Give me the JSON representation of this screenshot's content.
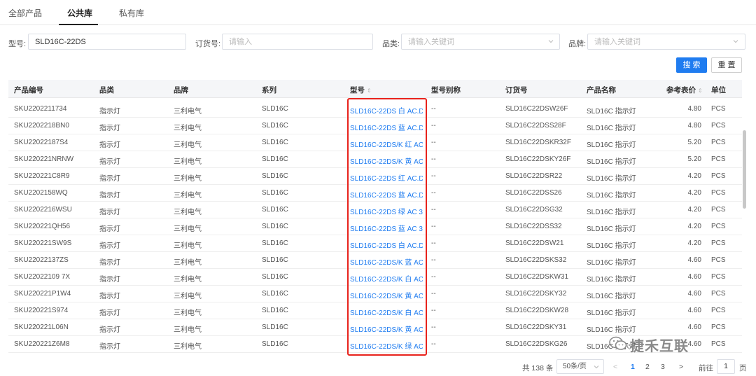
{
  "tabs": [
    {
      "label": "全部产品",
      "active": false
    },
    {
      "label": "公共库",
      "active": true
    },
    {
      "label": "私有库",
      "active": false
    }
  ],
  "filters": {
    "model": {
      "label": "型号:",
      "value": "SLD16C-22DS"
    },
    "order_no": {
      "label": "订货号:",
      "placeholder": "请输入"
    },
    "category": {
      "label": "品类:",
      "placeholder": "请输入关键词"
    },
    "brand": {
      "label": "品牌:",
      "placeholder": "请输入关键词"
    }
  },
  "buttons": {
    "search": "搜 索",
    "reset": "重 置"
  },
  "table": {
    "headers": [
      "产品编号",
      "品类",
      "品牌",
      "系列",
      "型号",
      "型号别称",
      "订货号",
      "产品名称",
      "参考表价",
      "单位"
    ],
    "rows": [
      [
        "SKU2202211734",
        "指示灯",
        "三利电气",
        "SLD16C",
        "SLD16C-22DS 白 AC.D...",
        "--",
        "SLD16C22DSW26F",
        "SLD16C 指示灯",
        "4.80",
        "PCS"
      ],
      [
        "SKU2202218BN0",
        "指示灯",
        "三利电气",
        "SLD16C",
        "SLD16C-22DS 蓝 AC.D...",
        "--",
        "SLD16C22DSS28F",
        "SLD16C 指示灯",
        "4.80",
        "PCS"
      ],
      [
        "SKU22022187S4",
        "指示灯",
        "三利电气",
        "SLD16C",
        "SLD16C-22DS/K 红 AC ...",
        "--",
        "SLD16C22DSKR32F",
        "SLD16C 指示灯",
        "5.20",
        "PCS"
      ],
      [
        "SKU220221NRNW",
        "指示灯",
        "三利电气",
        "SLD16C",
        "SLD16C-22DS/K 黄 AC...",
        "--",
        "SLD16C22DSKY26F",
        "SLD16C 指示灯",
        "5.20",
        "PCS"
      ],
      [
        "SKU220221C8R9",
        "指示灯",
        "三利电气",
        "SLD16C",
        "SLD16C-22DS 红 AC.D...",
        "--",
        "SLD16C22DSR22",
        "SLD16C 指示灯",
        "4.20",
        "PCS"
      ],
      [
        "SKU2202158WQ",
        "指示灯",
        "三利电气",
        "SLD16C",
        "SLD16C-22DS 蓝 AC.D...",
        "--",
        "SLD16C22DSS26",
        "SLD16C 指示灯",
        "4.20",
        "PCS"
      ],
      [
        "SKU2202216WSU",
        "指示灯",
        "三利电气",
        "SLD16C",
        "SLD16C-22DS 绿 AC 38...",
        "--",
        "SLD16C22DSG32",
        "SLD16C 指示灯",
        "4.20",
        "PCS"
      ],
      [
        "SKU220221QH56",
        "指示灯",
        "三利电气",
        "SLD16C",
        "SLD16C-22DS 蓝 AC 38...",
        "--",
        "SLD16C22DSS32",
        "SLD16C 指示灯",
        "4.20",
        "PCS"
      ],
      [
        "SKU220221SW9S",
        "指示灯",
        "三利电气",
        "SLD16C",
        "SLD16C-22DS 白 AC.D...",
        "--",
        "SLD16C22DSW21",
        "SLD16C 指示灯",
        "4.20",
        "PCS"
      ],
      [
        "SKU22022137ZS",
        "指示灯",
        "三利电气",
        "SLD16C",
        "SLD16C-22DS/K 蓝 AC...",
        "--",
        "SLD16C22DSKS32",
        "SLD16C 指示灯",
        "4.60",
        "PCS"
      ],
      [
        "SKU22022109 7X",
        "指示灯",
        "三利电气",
        "SLD16C",
        "SLD16C-22DS/K 白 AC...",
        "--",
        "SLD16C22DSKW31",
        "SLD16C 指示灯",
        "4.60",
        "PCS"
      ],
      [
        "SKU220221P1W4",
        "指示灯",
        "三利电气",
        "SLD16C",
        "SLD16C-22DS/K 黄 AC ...",
        "--",
        "SLD16C22DSKY32",
        "SLD16C 指示灯",
        "4.60",
        "PCS"
      ],
      [
        "SKU220221S974",
        "指示灯",
        "三利电气",
        "SLD16C",
        "SLD16C-22DS/K 白 AC...",
        "--",
        "SLD16C22DSKW28",
        "SLD16C 指示灯",
        "4.60",
        "PCS"
      ],
      [
        "SKU220221L06N",
        "指示灯",
        "三利电气",
        "SLD16C",
        "SLD16C-22DS/K 黄 AC...",
        "--",
        "SLD16C22DSKY31",
        "SLD16C 指示灯",
        "4.60",
        "PCS"
      ],
      [
        "SKU220221Z6M8",
        "指示灯",
        "三利电气",
        "SLD16C",
        "SLD16C-22DS/K 绿 AC...",
        "--",
        "SLD16C22DSKG26",
        "SLD16C 指示灯",
        "4.60",
        "PCS"
      ]
    ]
  },
  "pagination": {
    "total": "共 138 条",
    "page_size": "50条/页",
    "prev": "<",
    "pages": [
      "1",
      "2",
      "3"
    ],
    "next": ">",
    "goto_label": "前往",
    "goto_value": "1",
    "page_suffix": "页"
  },
  "watermark": {
    "text": "捷禾互联",
    "icon": "wechat-icon"
  },
  "colors": {
    "accent": "#1f7cf0",
    "highlight_border": "#e8231c",
    "header_bg": "#f5f6f8"
  }
}
